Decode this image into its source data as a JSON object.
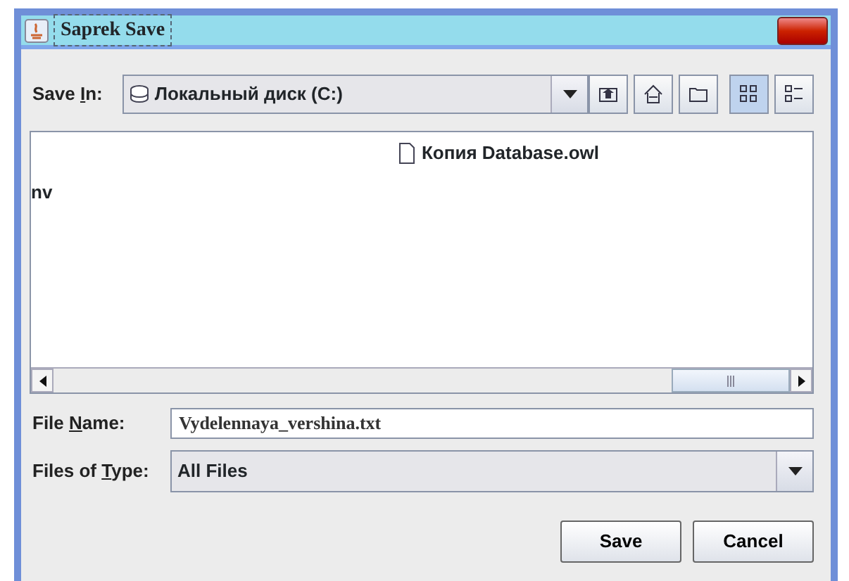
{
  "window": {
    "title": "Saprek Save"
  },
  "save_in": {
    "label_parts": [
      "Save ",
      "I",
      "n:"
    ],
    "value": "Локальный диск (C:)"
  },
  "toolbar": [
    {
      "kind": "up",
      "selected": false
    },
    {
      "kind": "home",
      "selected": false
    },
    {
      "kind": "new-folder",
      "selected": false
    },
    {
      "kind": "list",
      "selected": true
    },
    {
      "kind": "details",
      "selected": false
    }
  ],
  "files": [
    {
      "kind": "file",
      "name": "Копия Database.owl"
    },
    {
      "kind": "clipped",
      "name": "nv"
    }
  ],
  "file_name": {
    "label_parts": [
      "File ",
      "N",
      "ame:"
    ],
    "value": "Vydelennaya_vershina.txt"
  },
  "file_type": {
    "label_parts": [
      "Files of ",
      "T",
      "ype:"
    ],
    "value": "All Files"
  },
  "buttons": [
    "Save",
    "Cancel"
  ]
}
